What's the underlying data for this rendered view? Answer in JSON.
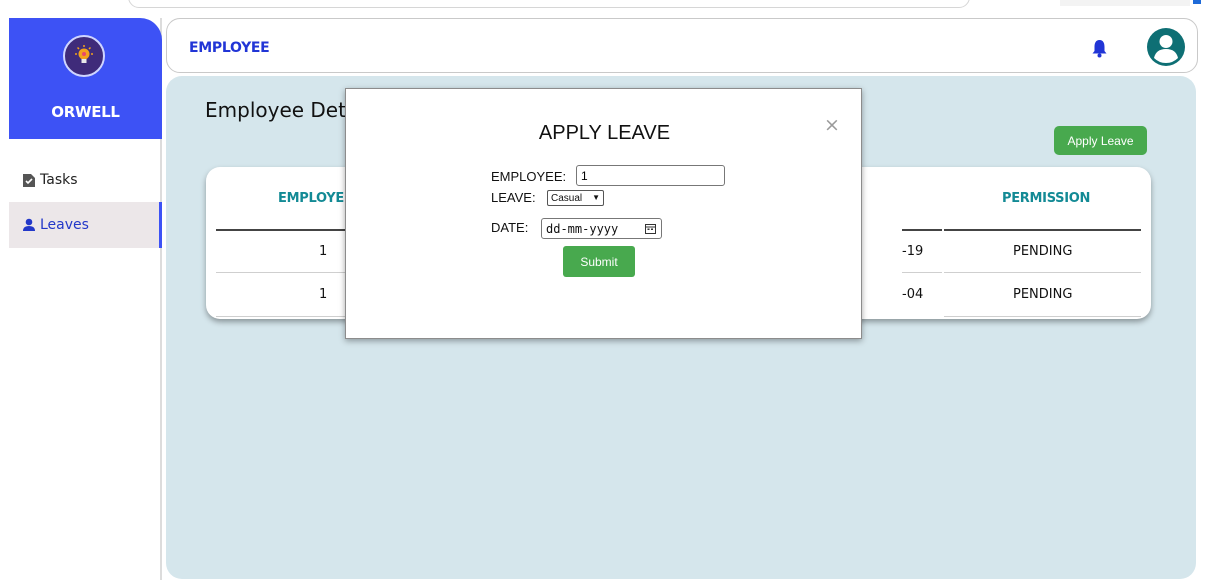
{
  "app": {
    "brand": "ORWELL"
  },
  "sidebar": {
    "items": [
      {
        "label": "Tasks",
        "icon": "task-file-icon",
        "active": false
      },
      {
        "label": "Leaves",
        "icon": "user-icon",
        "active": true
      }
    ]
  },
  "header": {
    "title": "EMPLOYEE",
    "bell_icon": "bell-icon",
    "avatar_icon": "user-circle-icon"
  },
  "main": {
    "page_title": "Employee Details",
    "apply_leave_label": "Apply Leave",
    "table": {
      "columns": [
        "EMPLOYEE",
        "PERMISSION"
      ],
      "rows": [
        {
          "employee": "1",
          "date_suffix": "-19",
          "permission": "PENDING"
        },
        {
          "employee": "1",
          "date_suffix": "-04",
          "permission": "PENDING"
        }
      ]
    }
  },
  "modal": {
    "title": "APPLY LEAVE",
    "close_glyph": "×",
    "employee_label": "EMPLOYEE:",
    "employee_value": "1",
    "leave_label": "LEAVE:",
    "leave_selected": "Casual",
    "date_label": "DATE:",
    "date_placeholder": "dd-mm-yyyy",
    "submit_label": "Submit"
  },
  "colors": {
    "brand_blue": "#3d52f5",
    "header_title": "#2135d6",
    "main_bg": "#d5e6ec",
    "accent_green": "#48a94e",
    "table_header_teal": "#138a95",
    "avatar_teal": "#0e6f74"
  }
}
